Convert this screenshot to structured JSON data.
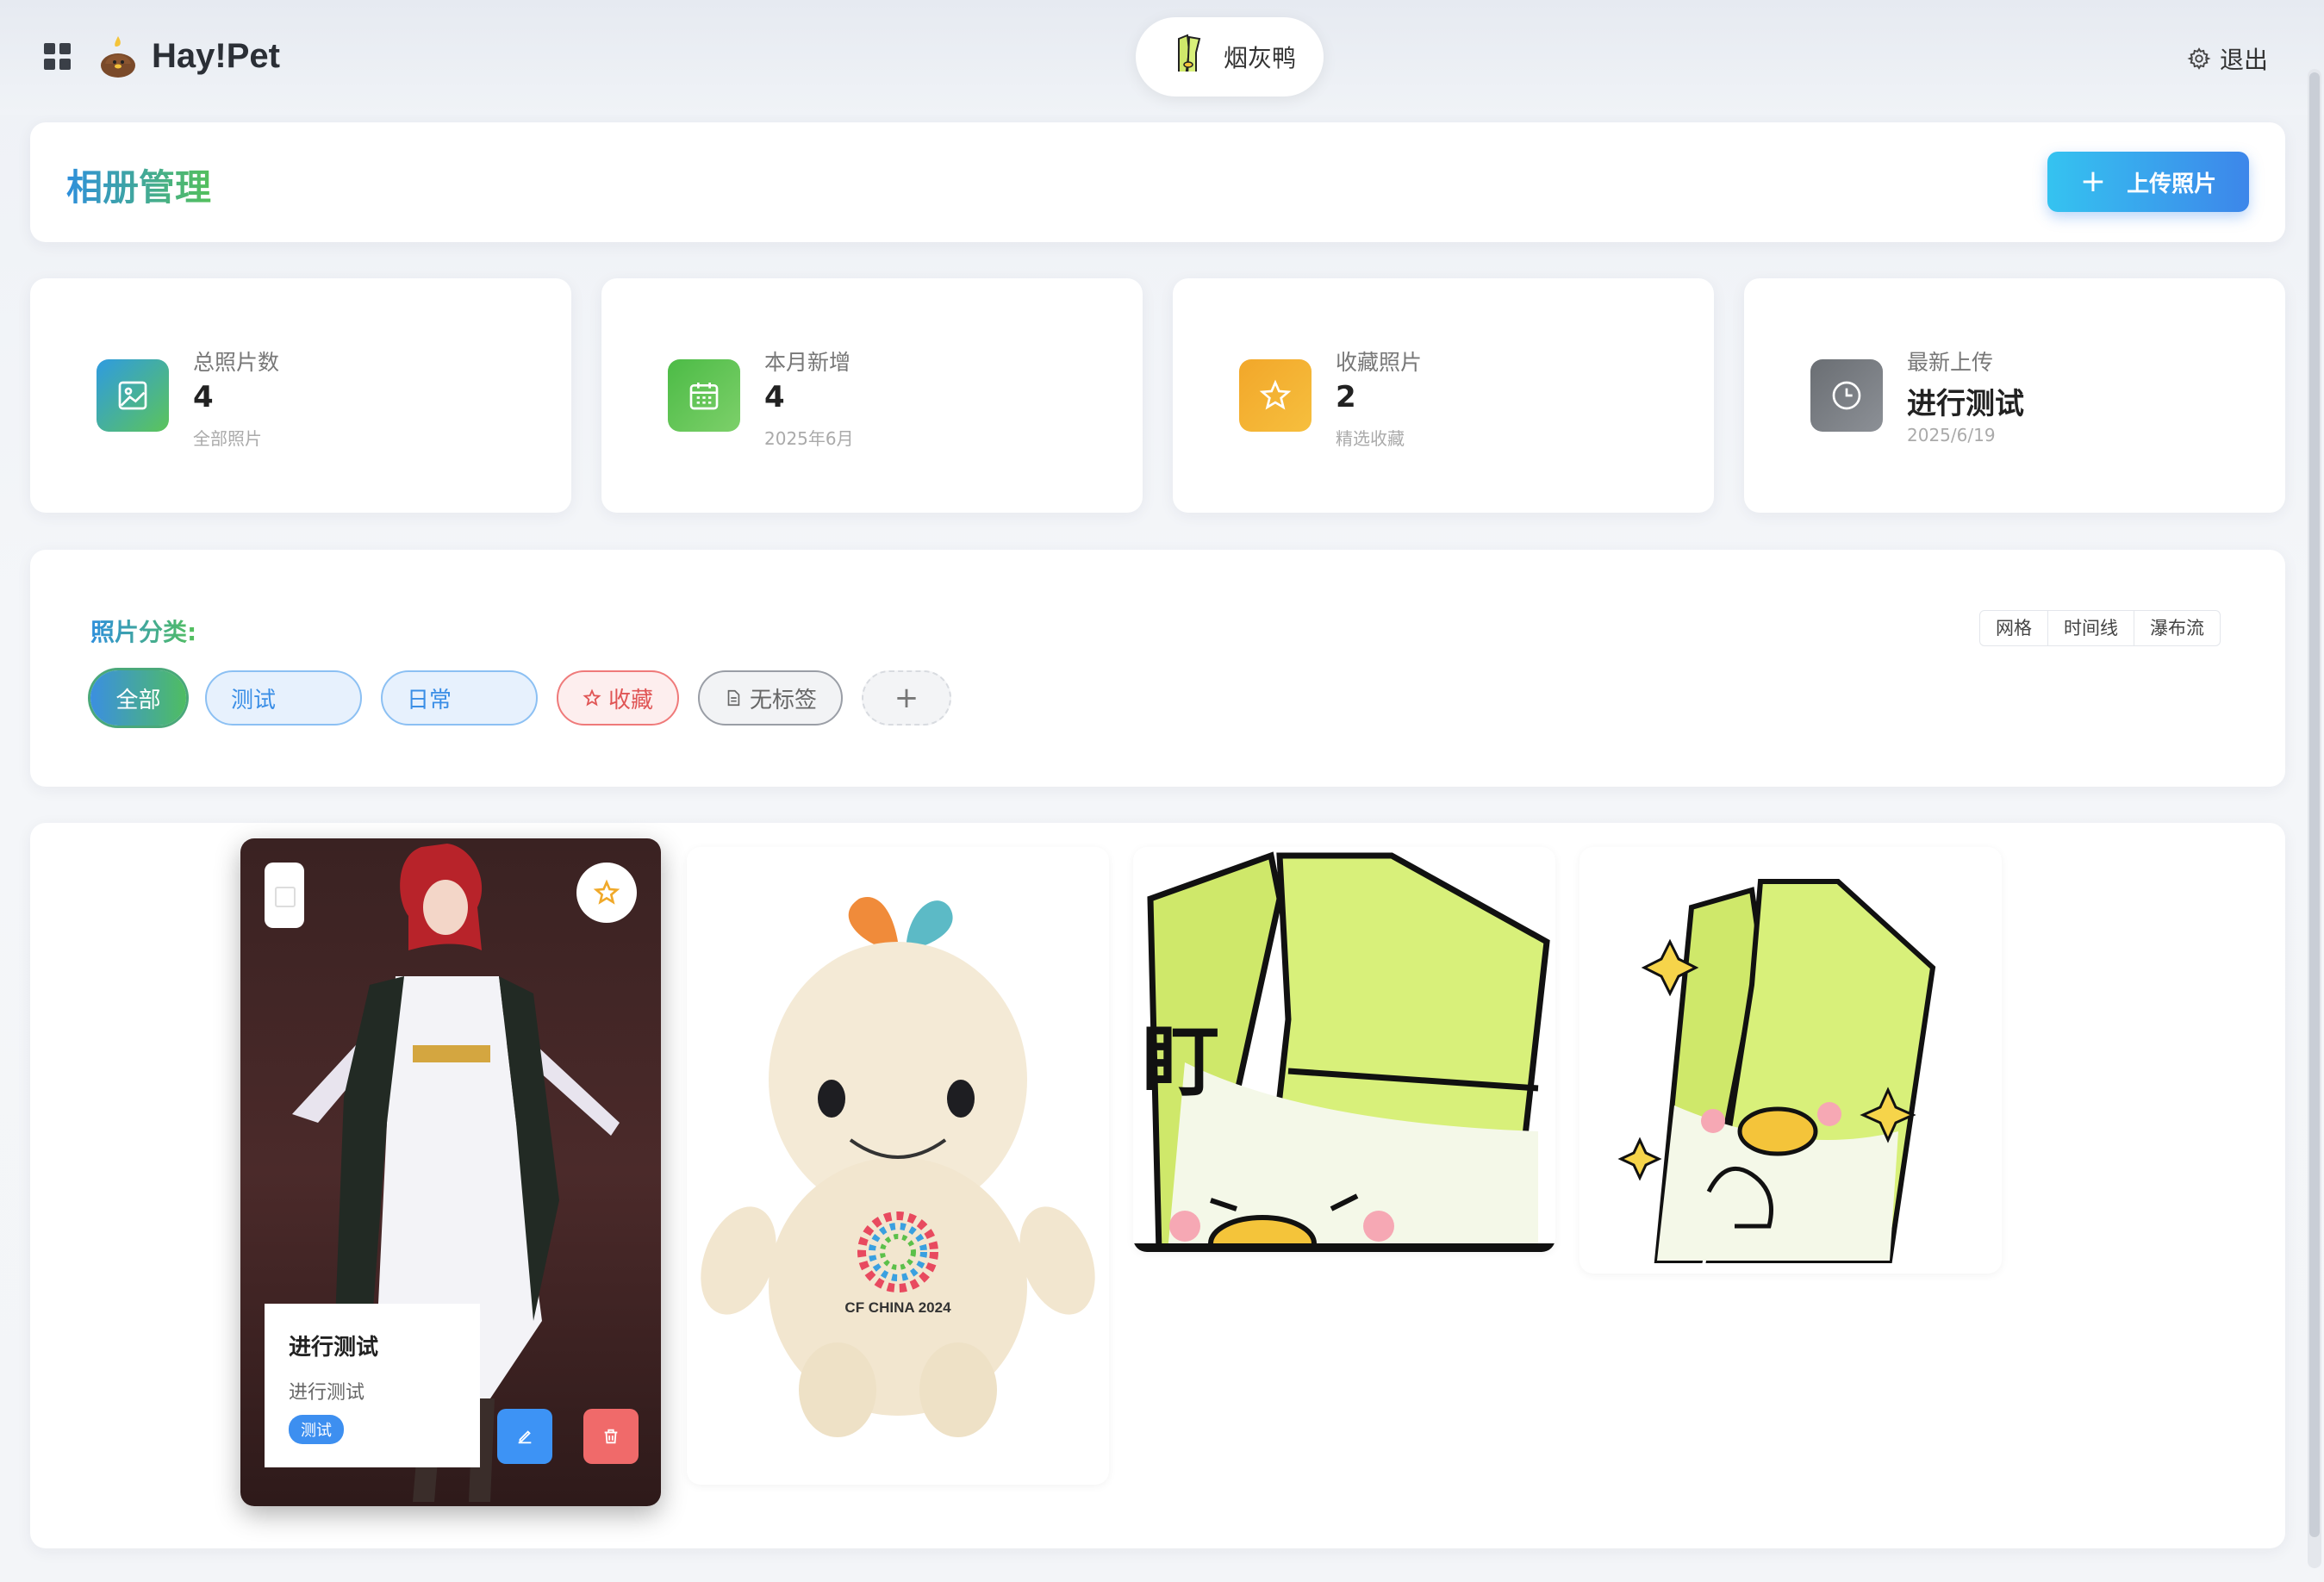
{
  "app": {
    "brand": "Hay!Pet"
  },
  "header": {
    "user_name": "烟灰鸭",
    "logout_label": "退出"
  },
  "page": {
    "title": "相册管理",
    "upload_label": "上传照片"
  },
  "stats": [
    {
      "label": "总照片数",
      "value": "4",
      "sub": "全部照片",
      "icon": "image-icon",
      "color": "#3aa3d8"
    },
    {
      "label": "本月新增",
      "value": "4",
      "sub": "2025年6月",
      "icon": "calendar-icon",
      "color": "#5cc04a"
    },
    {
      "label": "收藏照片",
      "value": "2",
      "sub": "精选收藏",
      "icon": "star-icon",
      "color": "#f0a92a"
    },
    {
      "label": "最新上传",
      "value": "进行测试",
      "sub": "2025/6/19",
      "icon": "clock-icon",
      "color": "#6f7378"
    }
  ],
  "filter": {
    "title": "照片分类:",
    "views": [
      "网格",
      "时间线",
      "瀑布流"
    ],
    "tags": [
      "全部",
      "测试",
      "日常",
      "收藏",
      "无标签"
    ],
    "add_label": "+"
  },
  "photos": [
    {
      "title": "进行测试",
      "description": "进行测试",
      "tag": "测试"
    },
    {
      "caption": "CF CHINA 2024"
    },
    {
      "caption": "盯"
    },
    {
      "caption": ""
    }
  ]
}
